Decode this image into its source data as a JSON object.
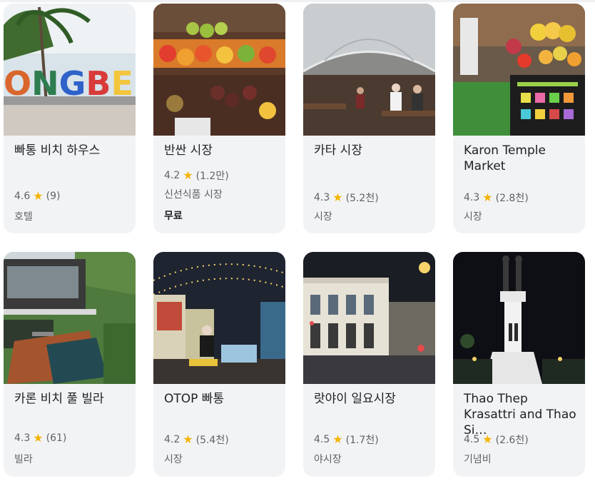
{
  "places": [
    {
      "title": "빠통 비치 하우스",
      "rating": "4.6",
      "star": "★",
      "reviews": "(9)",
      "category": "호텔",
      "extra": ""
    },
    {
      "title": "반싼 시장",
      "rating": "4.2",
      "star": "★",
      "reviews": "(1.2만)",
      "category": "신선식품 시장",
      "extra": "무료"
    },
    {
      "title": "카타 시장",
      "rating": "4.3",
      "star": "★",
      "reviews": "(5.2천)",
      "category": "시장",
      "extra": ""
    },
    {
      "title": "Karon Temple Market",
      "rating": "4.3",
      "star": "★",
      "reviews": "(2.8천)",
      "category": "시장",
      "extra": ""
    },
    {
      "title": "카론 비치 풀 빌라",
      "rating": "4.3",
      "star": "★",
      "reviews": "(61)",
      "category": "빌라",
      "extra": ""
    },
    {
      "title": "OTOP 빠통",
      "rating": "4.2",
      "star": "★",
      "reviews": "(5.4천)",
      "category": "시장",
      "extra": ""
    },
    {
      "title": "랏야이 일요시장",
      "rating": "4.5",
      "star": "★",
      "reviews": "(1.7천)",
      "category": "야시장",
      "extra": ""
    },
    {
      "title": "Thao Thep Krasattri and Thao Si…",
      "rating": "4.5",
      "star": "★",
      "reviews": "(2.6천)",
      "category": "기념비",
      "extra": ""
    }
  ],
  "sign_letters": "ONGBE",
  "colors": {
    "star": "#f4b400",
    "card_bg": "#f2f3f5",
    "title": "#202124",
    "muted": "#5f6368"
  }
}
